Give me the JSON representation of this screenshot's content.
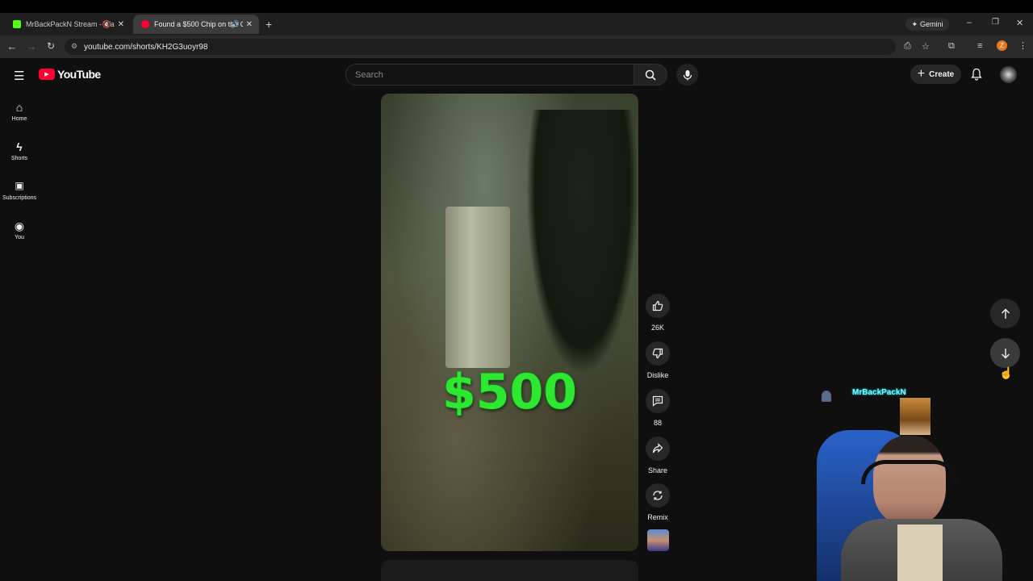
{
  "browser": {
    "tabs": [
      {
        "title": "MrBackPackN Stream - Wa",
        "favicon_color": "#53fc18"
      },
      {
        "title": "Found a $500 Chip on the C",
        "favicon_color": "#ff0033"
      }
    ],
    "url": "youtube.com/shorts/KH2G3uoyr98",
    "gemini_label": "Gemini",
    "profile_initial": "Z"
  },
  "youtube": {
    "logo_text": "YouTube",
    "search_placeholder": "Search",
    "create_label": "Create",
    "sidebar": [
      {
        "label": "Home",
        "icon": "home-icon"
      },
      {
        "label": "Shorts",
        "icon": "shorts-icon"
      },
      {
        "label": "Subscriptions",
        "icon": "subscriptions-icon"
      },
      {
        "label": "You",
        "icon": "you-icon"
      }
    ],
    "short": {
      "overlay_text": "$500",
      "likes": "26K",
      "dislike_label": "Dislike",
      "comments": "88",
      "share_label": "Share",
      "remix_label": "Remix"
    }
  },
  "webcam": {
    "streamer_name": "MrBackPackN"
  }
}
